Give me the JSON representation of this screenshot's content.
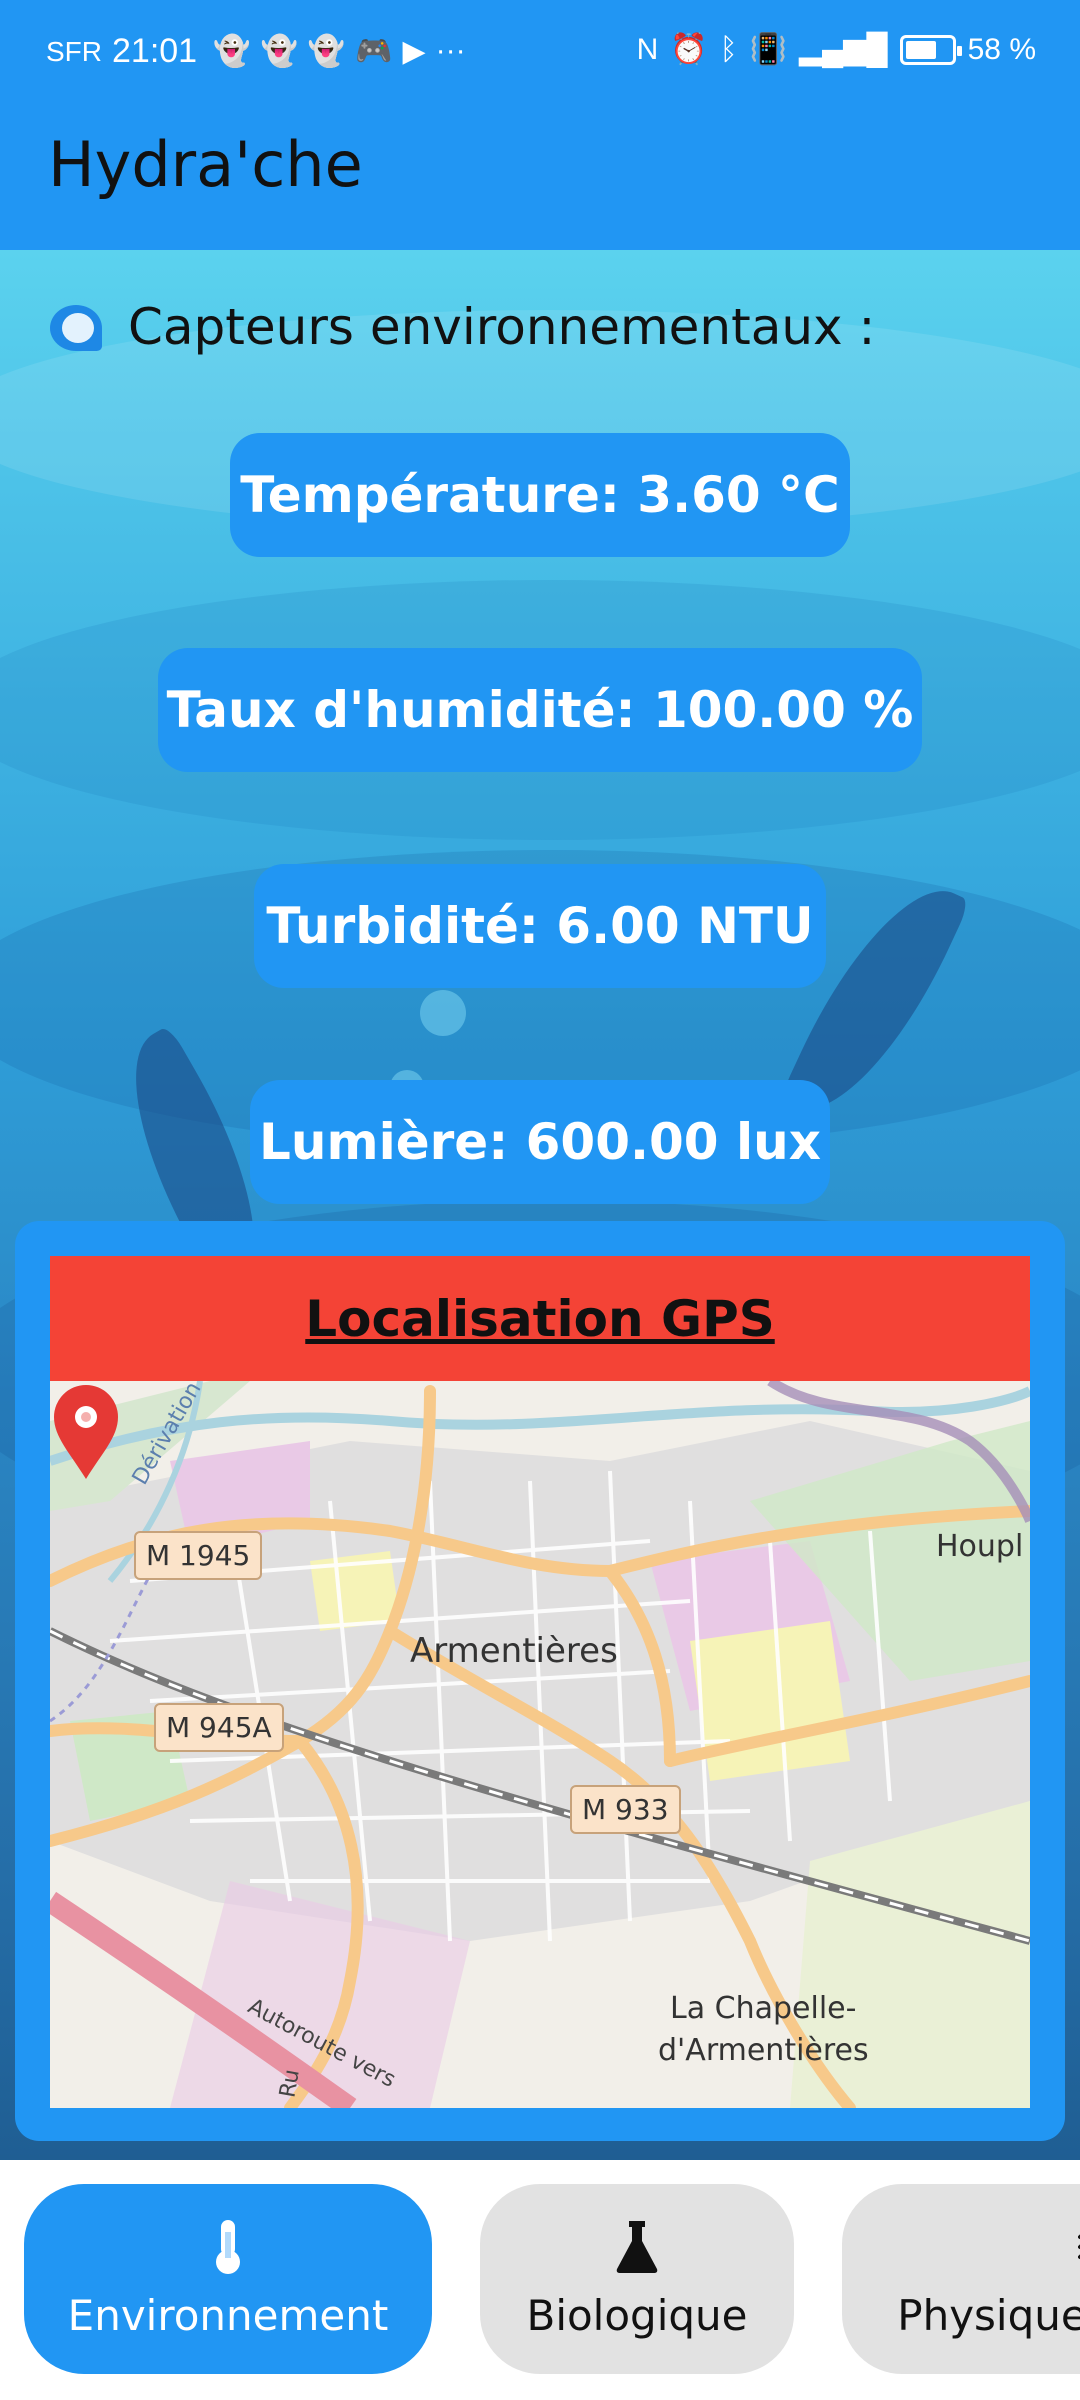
{
  "status_bar": {
    "carrier": "SFR",
    "time": "21:01",
    "notification_icons": [
      "snapchat-icon",
      "snapchat-icon",
      "snapchat-icon",
      "discord-icon",
      "youtube-icon",
      "more-icon"
    ],
    "system_icons": [
      "nfc-icon",
      "alarm-icon",
      "bluetooth-icon",
      "vibrate-icon",
      "signal-icon",
      "battery-icon"
    ],
    "battery_percent": "58 %",
    "battery_level": 0.58
  },
  "app_bar": {
    "title": "Hydra'che"
  },
  "sensors": {
    "heading": "Capteurs environnementaux :",
    "items": [
      {
        "label": "Température: 3.60 °C"
      },
      {
        "label": "Taux d'humidité: 100.00 %"
      },
      {
        "label": "Turbidité: 6.00 NTU"
      },
      {
        "label": "Lumière: 600.00 lux"
      }
    ]
  },
  "gps": {
    "title": "Localisation GPS",
    "map": {
      "places": [
        "Armentières",
        "Houpl",
        "La Chapelle-",
        "d'Armentières"
      ],
      "roads": [
        "M 1945",
        "M 945A",
        "M 933"
      ],
      "road_labels": [
        "Dérivation",
        "Autoroute vers",
        "Ru"
      ]
    }
  },
  "bottom_nav": {
    "items": [
      {
        "label": "Environnement",
        "icon": "thermometer-icon",
        "active": true
      },
      {
        "label": "Biologique",
        "icon": "flask-icon",
        "active": false
      },
      {
        "label": "Physique",
        "icon": "waves-icon",
        "active": false
      }
    ]
  },
  "colors": {
    "primary": "#2196f3",
    "gps_header": "#f44336",
    "nav_inactive": "#e2e2e2",
    "map_pin": "#e53935"
  }
}
